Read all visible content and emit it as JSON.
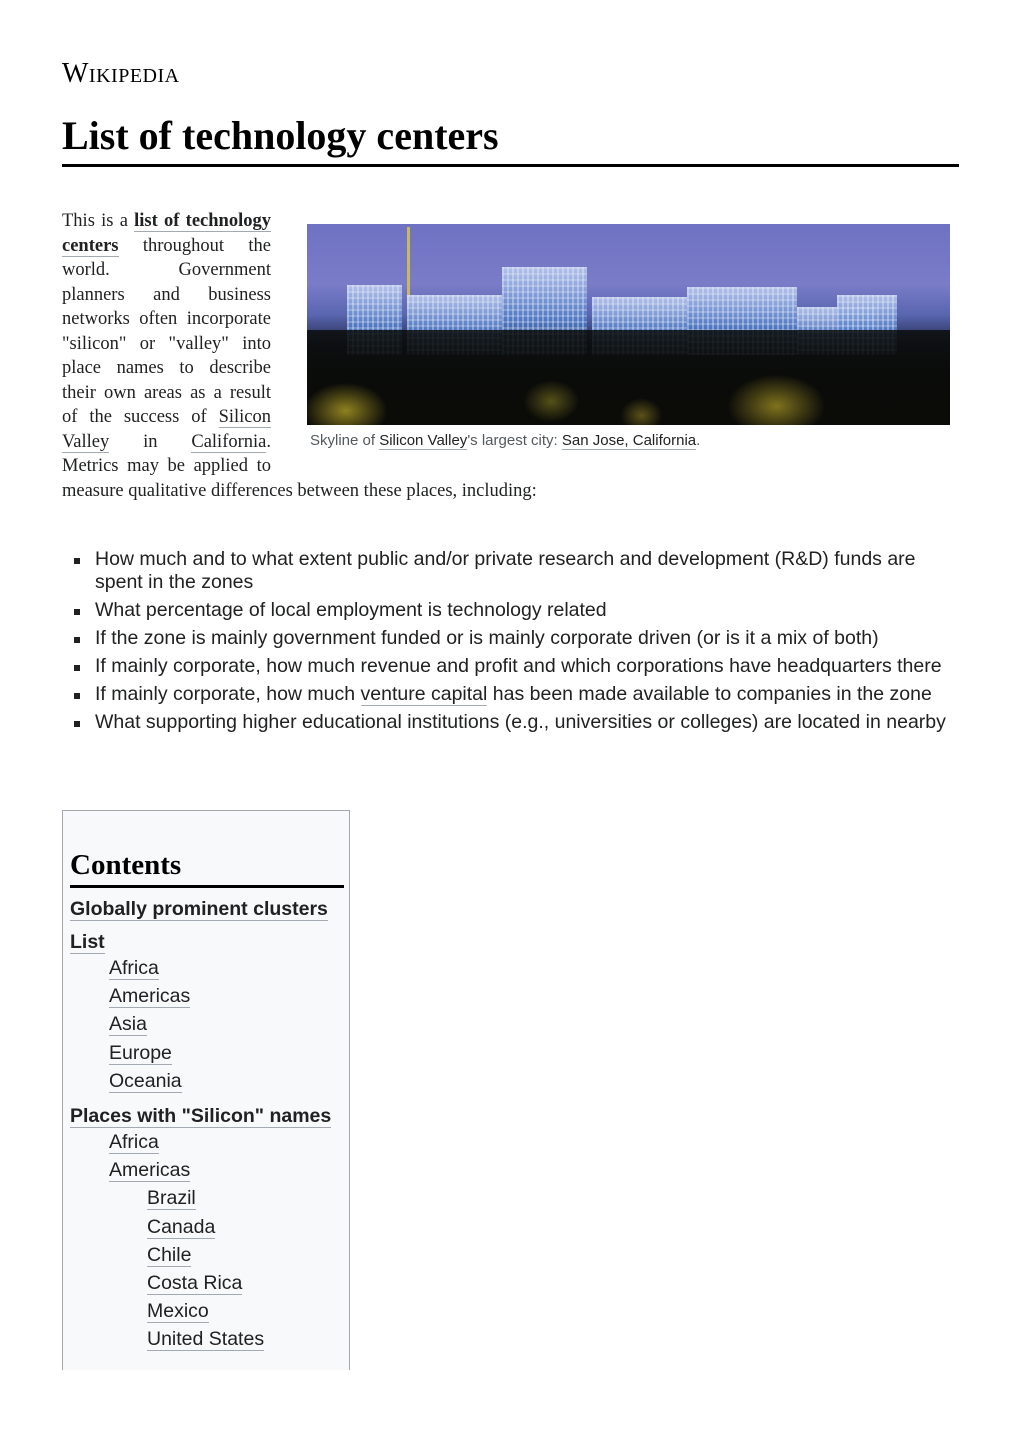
{
  "header": {
    "wordmark": "Wikipedia",
    "title": "List of technology centers"
  },
  "intro": {
    "part1": "This is a ",
    "bold_link": "list of technology centers",
    "part2": " throughout the world. Government planners and business networks often incorporate \"silicon\" or \"valley\" into place names to describe their own areas as a result of the success of ",
    "link_silicon_valley": "Silicon Valley",
    "part3": " in ",
    "link_california": "California",
    "part4": ". Metrics may be applied to measure qualitative differences between these places, including:"
  },
  "figure": {
    "image_alt": "Skyline of San Jose at night",
    "caption_part1": "Skyline of ",
    "caption_link1": "Silicon Valley",
    "caption_part2": "'s largest city: ",
    "caption_link2": "San Jose, California",
    "caption_part3": "."
  },
  "bullets": [
    {
      "text": "How much and to what extent public and/or private research and development (R&D) funds are spent in the zones"
    },
    {
      "text": "What percentage of local employment is technology related"
    },
    {
      "text": "If the zone is mainly government funded or is mainly corporate driven (or is it a mix of both)"
    },
    {
      "text": "If mainly corporate, how much revenue and profit and which corporations have headquarters there"
    },
    {
      "before": "If mainly corporate, how much ",
      "link": "venture capital",
      "after": " has been made available to companies in the zone"
    },
    {
      "text": "What supporting higher educational institutions (e.g., universities or colleges) are located in nearby"
    }
  ],
  "toc": {
    "title": "Contents",
    "items": [
      {
        "label": "Globally prominent clusters",
        "level": 1
      },
      {
        "label": "List",
        "level": 1
      },
      {
        "label": "Africa",
        "level": 2
      },
      {
        "label": "Americas",
        "level": 2
      },
      {
        "label": "Asia",
        "level": 2
      },
      {
        "label": "Europe",
        "level": 2
      },
      {
        "label": "Oceania",
        "level": 2
      },
      {
        "label": "Places with \"Silicon\" names",
        "level": 1
      },
      {
        "label": "Africa",
        "level": 2
      },
      {
        "label": "Americas",
        "level": 2
      },
      {
        "label": "Brazil",
        "level": 3
      },
      {
        "label": "Canada",
        "level": 3
      },
      {
        "label": "Chile",
        "level": 3
      },
      {
        "label": "Costa Rica",
        "level": 3
      },
      {
        "label": "Mexico",
        "level": 3
      },
      {
        "label": "United States",
        "level": 3
      }
    ]
  }
}
